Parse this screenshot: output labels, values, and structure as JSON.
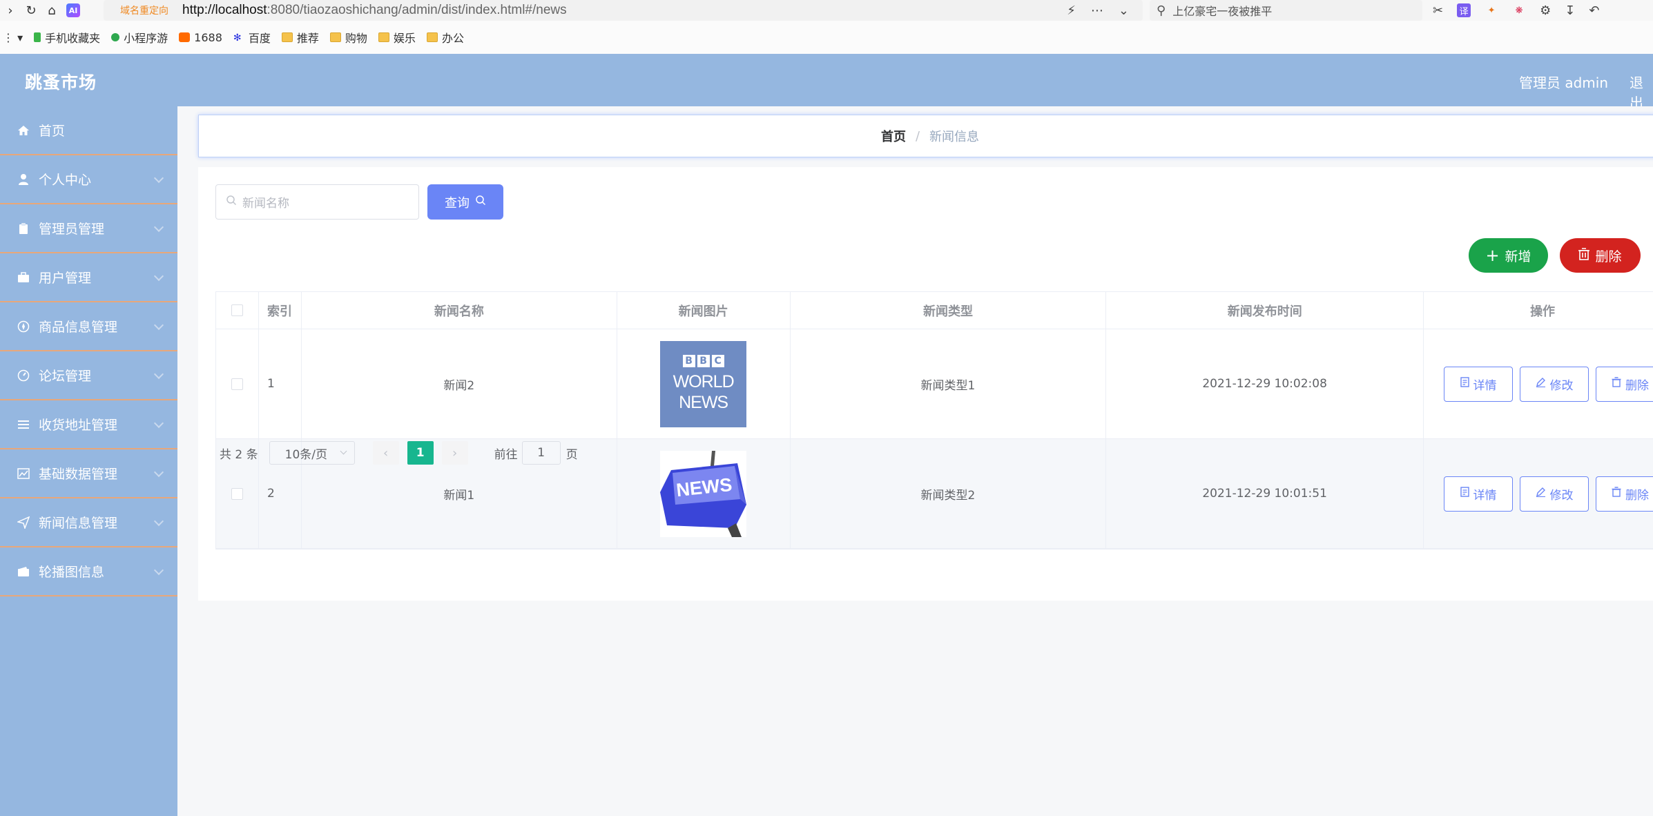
{
  "browser": {
    "redirect_label": "域名重定向",
    "url_host": "http://localhost",
    "url_rest": ":8080/tiaozaoshichang/admin/dist/index.html#/news",
    "search_placeholder": "上亿豪宅一夜被推平",
    "ext_translate": "译"
  },
  "bookmarks": [
    {
      "label": "手机收藏夹",
      "icon": "phone-icon"
    },
    {
      "label": "小程序游",
      "icon": "miniprogram-icon"
    },
    {
      "label": "1688",
      "icon": "1688-icon"
    },
    {
      "label": "百度",
      "icon": "baidu-icon"
    },
    {
      "label": "推荐",
      "icon": "folder-icon"
    },
    {
      "label": "购物",
      "icon": "folder-icon"
    },
    {
      "label": "娱乐",
      "icon": "folder-icon"
    },
    {
      "label": "办公",
      "icon": "folder-icon"
    }
  ],
  "header": {
    "brand": "跳蚤市场",
    "user": "管理员 admin",
    "logout": "退出"
  },
  "sidebar": {
    "items": [
      {
        "label": "首页",
        "icon": "home-icon"
      },
      {
        "label": "个人中心",
        "icon": "user-icon"
      },
      {
        "label": "管理员管理",
        "icon": "clipboard-icon"
      },
      {
        "label": "用户管理",
        "icon": "briefcase-icon"
      },
      {
        "label": "商品信息管理",
        "icon": "compass-icon"
      },
      {
        "label": "论坛管理",
        "icon": "gauge-icon"
      },
      {
        "label": "收货地址管理",
        "icon": "list-icon"
      },
      {
        "label": "基础数据管理",
        "icon": "chart-icon"
      },
      {
        "label": "新闻信息管理",
        "icon": "send-icon"
      },
      {
        "label": "轮播图信息",
        "icon": "wallet-icon"
      }
    ]
  },
  "breadcrumb": {
    "home": "首页",
    "separator": "/",
    "current": "新闻信息"
  },
  "search": {
    "placeholder": "新闻名称",
    "query_label": "查询"
  },
  "actions": {
    "add_label": "新增",
    "delete_label": "删除"
  },
  "table": {
    "headers": {
      "index": "索引",
      "name": "新闻名称",
      "image": "新闻图片",
      "type": "新闻类型",
      "time": "新闻发布时间",
      "ops": "操作"
    },
    "rows": [
      {
        "index": "1",
        "name": "新闻2",
        "type": "新闻类型1",
        "time": "2021-12-29 10:02:08",
        "image_bbc_letters": [
          "B",
          "B",
          "C"
        ],
        "image_line1": "WORLD",
        "image_line2": "NEWS"
      },
      {
        "index": "2",
        "name": "新闻1",
        "type": "新闻类型2",
        "time": "2021-12-29 10:01:51",
        "image_caption": "NEWS"
      }
    ],
    "row_actions": {
      "detail": "详情",
      "edit": "修改",
      "delete": "删除"
    }
  },
  "pagination": {
    "total": "共 2 条",
    "page_size": "10条/页",
    "current_page": "1",
    "goto_label": "前往",
    "goto_value": "1",
    "page_suffix": "页"
  },
  "colors": {
    "primary": "#6a85f6",
    "sidebar_bg": "#95b7e0",
    "success": "#1aa34a",
    "danger": "#d3231f",
    "page_active": "#17b68f"
  }
}
